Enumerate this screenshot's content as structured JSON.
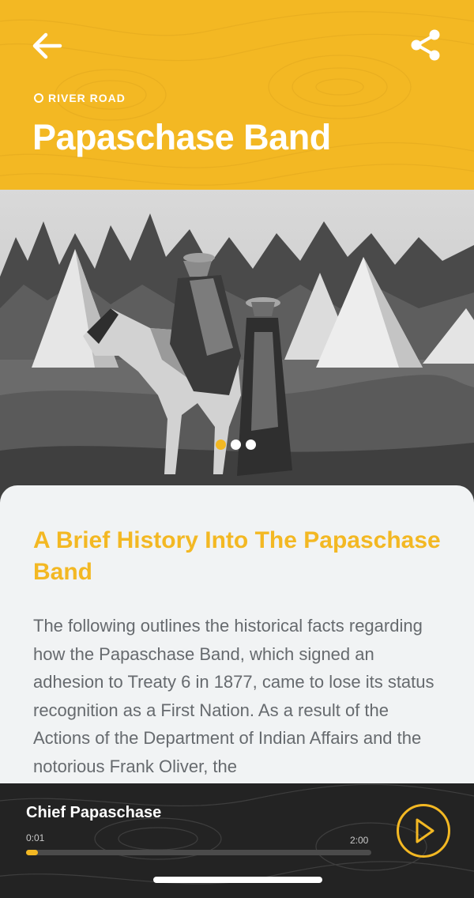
{
  "header": {
    "back_icon": "arrow-left-icon",
    "share_icon": "share-icon",
    "location_label": "RIVER ROAD",
    "title": "Papaschase Band",
    "background_color": "#f3b823"
  },
  "gallery": {
    "image_description": "Black and white historical photograph",
    "slide_count": 3,
    "active_slide": 1,
    "active_color": "#f3b823"
  },
  "article": {
    "heading": "A Brief History Into The Papaschase Band",
    "body": "The following outlines the historical facts regarding how the Papaschase Band, which signed an adhesion to Treaty 6 in 1877, came to lose its status recognition as a First Nation. As a result of the Actions of the Department of Indian Affairs and the notorious Frank Oliver, the"
  },
  "player": {
    "track_title": "Chief Papaschase",
    "current_time": "0:01",
    "total_time": "2:00",
    "progress_fraction": 0.035,
    "play_icon": "play-icon",
    "accent_color": "#f3b823"
  }
}
